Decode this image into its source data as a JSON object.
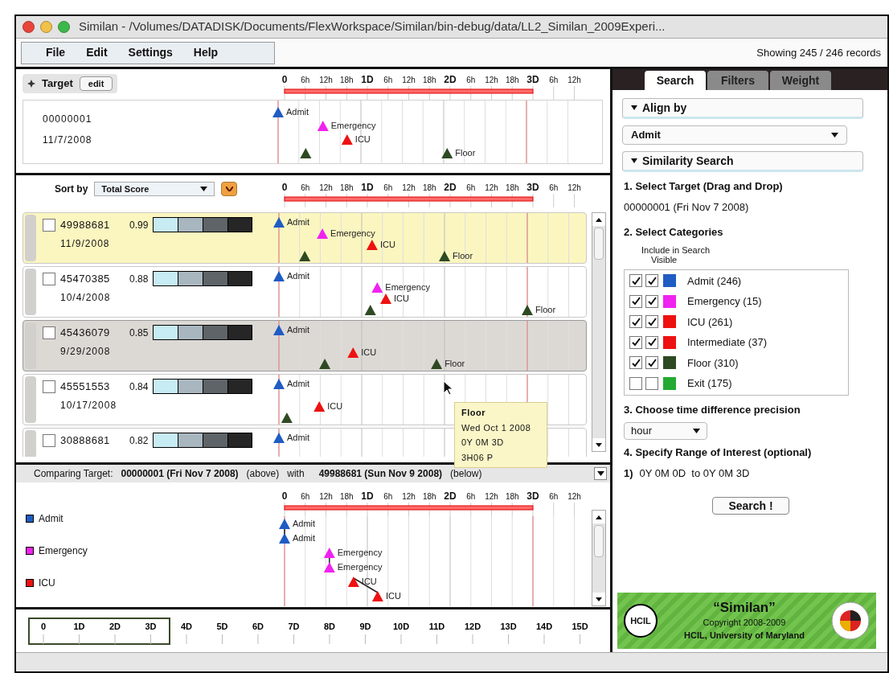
{
  "window": {
    "title": "Similan - /Volumes/DATADISK/Documents/FlexWorkspace/Similan/bin-debug/data/LL2_Similan_2009Experi..."
  },
  "menu": [
    "File",
    "Edit",
    "Settings",
    "Help"
  ],
  "record_count": "Showing 245 / 246 records",
  "target": {
    "title": "Target",
    "edit_button": "edit",
    "axis": {
      "ticks": [
        {
          "label": "0",
          "major": true
        },
        {
          "label": "6h",
          "major": false
        },
        {
          "label": "12h",
          "major": false
        },
        {
          "label": "18h",
          "major": false
        },
        {
          "label": "1D",
          "major": true
        },
        {
          "label": "6h",
          "major": false
        },
        {
          "label": "12h",
          "major": false
        },
        {
          "label": "18h",
          "major": false
        },
        {
          "label": "2D",
          "major": true
        },
        {
          "label": "6h",
          "major": false
        },
        {
          "label": "12h",
          "major": false
        },
        {
          "label": "18h",
          "major": false
        },
        {
          "label": "3D",
          "major": true
        },
        {
          "label": "6h",
          "major": false
        },
        {
          "label": "12h",
          "major": false
        }
      ]
    },
    "record": {
      "id": "00000001",
      "date": "11/7/2008",
      "events": [
        {
          "kind": "admit",
          "label": "Admit",
          "color": "#1f5cc4"
        },
        {
          "kind": "emergency",
          "label": "Emergency",
          "color": "#f022f0"
        },
        {
          "kind": "icu",
          "label": "ICU",
          "color": "#ee1111"
        },
        {
          "kind": "floor",
          "color": "#2e4a22"
        },
        {
          "kind": "floor",
          "label": "Floor",
          "color": "#2e4a22"
        }
      ]
    }
  },
  "list": {
    "sort_label": "Sort by",
    "sort_value": "Total Score",
    "axis": {
      "ticks": [
        {
          "label": "0",
          "major": true
        },
        {
          "label": "6h",
          "major": false
        },
        {
          "label": "12h",
          "major": false
        },
        {
          "label": "18h",
          "major": false
        },
        {
          "label": "1D",
          "major": true
        },
        {
          "label": "6h",
          "major": false
        },
        {
          "label": "12h",
          "major": false
        },
        {
          "label": "18h",
          "major": false
        },
        {
          "label": "2D",
          "major": true
        },
        {
          "label": "6h",
          "major": false
        },
        {
          "label": "12h",
          "major": false
        },
        {
          "label": "18h",
          "major": false
        },
        {
          "label": "3D",
          "major": true
        },
        {
          "label": "6h",
          "major": false
        },
        {
          "label": "12h",
          "major": false
        }
      ]
    },
    "rows": [
      {
        "id": "49988681",
        "score": "0.99",
        "date": "11/9/2008",
        "checked": false,
        "selected": true,
        "hovered": false,
        "events": [
          {
            "kind": "admit",
            "label": "Admit",
            "color": "#1f5cc4"
          },
          {
            "kind": "emergency",
            "label": "Emergency",
            "color": "#f022f0"
          },
          {
            "kind": "icu",
            "label": "ICU",
            "color": "#ee1111"
          },
          {
            "kind": "floor",
            "color": "#2e4a22"
          },
          {
            "kind": "floor",
            "label": "Floor",
            "color": "#2e4a22"
          }
        ]
      },
      {
        "id": "45470385",
        "score": "0.88",
        "date": "10/4/2008",
        "checked": false,
        "selected": false,
        "hovered": false,
        "events": [
          {
            "kind": "admit",
            "label": "Admit",
            "color": "#1f5cc4"
          },
          {
            "kind": "emergency",
            "label": "Emergency",
            "color": "#f022f0"
          },
          {
            "kind": "icu",
            "label": "ICU",
            "color": "#ee1111"
          },
          {
            "kind": "floor",
            "color": "#2e4a22"
          },
          {
            "kind": "floor",
            "label": "Floor",
            "color": "#2e4a22"
          }
        ]
      },
      {
        "id": "45436079",
        "score": "0.85",
        "date": "9/29/2008",
        "checked": false,
        "selected": false,
        "hovered": true,
        "events": [
          {
            "kind": "admit",
            "label": "Admit",
            "color": "#1f5cc4"
          },
          {
            "kind": "icu",
            "label": "ICU",
            "color": "#ee1111"
          },
          {
            "kind": "floor",
            "color": "#2e4a22"
          },
          {
            "kind": "floor",
            "label": "Floor",
            "color": "#2e4a22"
          }
        ]
      },
      {
        "id": "45551553",
        "score": "0.84",
        "date": "10/17/2008",
        "checked": false,
        "selected": false,
        "hovered": false,
        "events": [
          {
            "kind": "admit",
            "label": "Admit",
            "color": "#1f5cc4"
          },
          {
            "kind": "icu",
            "label": "ICU",
            "color": "#ee1111"
          },
          {
            "kind": "floor",
            "color": "#2e4a22"
          }
        ]
      },
      {
        "id": "30888681",
        "score": "0.82",
        "checked": false,
        "selected": false,
        "hovered": false,
        "events": [
          {
            "kind": "admit",
            "label": "Admit",
            "color": "#1f5cc4"
          }
        ]
      }
    ],
    "tooltip": {
      "title": "Floor",
      "lines": [
        "Wed Oct 1 2008",
        "0Y 0M 3D",
        "3H06 P"
      ]
    }
  },
  "compare": {
    "label": "Comparing Target:",
    "target": "00000001 (Fri Nov 7 2008)",
    "target_note": "(above)",
    "joiner": "with",
    "compared": "49988681 (Sun Nov 9 2008)",
    "compared_note": "(below)",
    "legend": [
      {
        "label": "Admit",
        "color": "#1f5cc4"
      },
      {
        "label": "Emergency",
        "color": "#f022f0"
      },
      {
        "label": "ICU",
        "color": "#ee1111"
      }
    ],
    "axis": {
      "ticks": [
        {
          "label": "0",
          "major": true
        },
        {
          "label": "6h",
          "major": false
        },
        {
          "label": "12h",
          "major": false
        },
        {
          "label": "18h",
          "major": false
        },
        {
          "label": "1D",
          "major": true
        },
        {
          "label": "6h",
          "major": false
        },
        {
          "label": "12h",
          "major": false
        },
        {
          "label": "18h",
          "major": false
        },
        {
          "label": "2D",
          "major": true
        },
        {
          "label": "6h",
          "major": false
        },
        {
          "label": "12h",
          "major": false
        },
        {
          "label": "18h",
          "major": false
        },
        {
          "label": "3D",
          "major": true
        },
        {
          "label": "6h",
          "major": false
        },
        {
          "label": "12h",
          "major": false
        }
      ]
    },
    "record": {
      "events": [
        {
          "label": "Admit",
          "color": "#1f5cc4"
        },
        {
          "label": "Admit",
          "color": "#1f5cc4"
        },
        {
          "label": "Emergency",
          "color": "#f022f0"
        },
        {
          "label": "Emergency",
          "color": "#f022f0"
        },
        {
          "label": "ICU",
          "color": "#ee1111"
        },
        {
          "label": "ICU",
          "color": "#ee1111"
        }
      ]
    }
  },
  "overview": {
    "ticks": [
      "0",
      "1D",
      "2D",
      "3D",
      "4D",
      "5D",
      "6D",
      "7D",
      "8D",
      "9D",
      "10D",
      "11D",
      "12D",
      "13D",
      "14D",
      "15D"
    ],
    "level": 0.25
  },
  "tabs": [
    {
      "label": "Search",
      "selected": true
    },
    {
      "label": "Filters",
      "selected": false
    },
    {
      "label": "Weight",
      "selected": false
    }
  ],
  "align_by": {
    "title": "Align by",
    "expanded": true,
    "value": "Admit"
  },
  "similarity": {
    "title": "Similarity Search",
    "expanded": true,
    "step1": "1. Select Target (Drag and Drop)",
    "target": "00000001 (Fri Nov 7 2008)",
    "step2": "2. Select Categories",
    "include_label": "Include in Search",
    "visible_label": "Visible",
    "categories": [
      {
        "label": "Admit (246)",
        "included": true,
        "visible": true,
        "color": "#1f5cc4"
      },
      {
        "label": "Emergency (15)",
        "included": true,
        "visible": true,
        "color": "#f022f0"
      },
      {
        "label": "ICU (261)",
        "included": true,
        "visible": true,
        "color": "#ee1111"
      },
      {
        "label": "Intermediate (37)",
        "included": true,
        "visible": true,
        "color": "#ee1111"
      },
      {
        "label": "Floor (310)",
        "included": true,
        "visible": true,
        "color": "#2e4a22"
      },
      {
        "label": "Exit (175)",
        "included": false,
        "visible": false,
        "color": "#22aa33"
      }
    ],
    "step3": "3. Choose time difference precision",
    "precision": "hour",
    "step4": "4. Specify Range of Interest (optional)",
    "ranges": [
      {
        "index": "1)",
        "text": "0Y 0M 0D  to 0Y 0M 3D"
      }
    ],
    "search_button": "Search !"
  },
  "banner": {
    "title": "“Similan”",
    "copyright": "Copyright 2008-2009",
    "org": "HCIL, University of Maryland",
    "logo_text": "HCIL"
  }
}
